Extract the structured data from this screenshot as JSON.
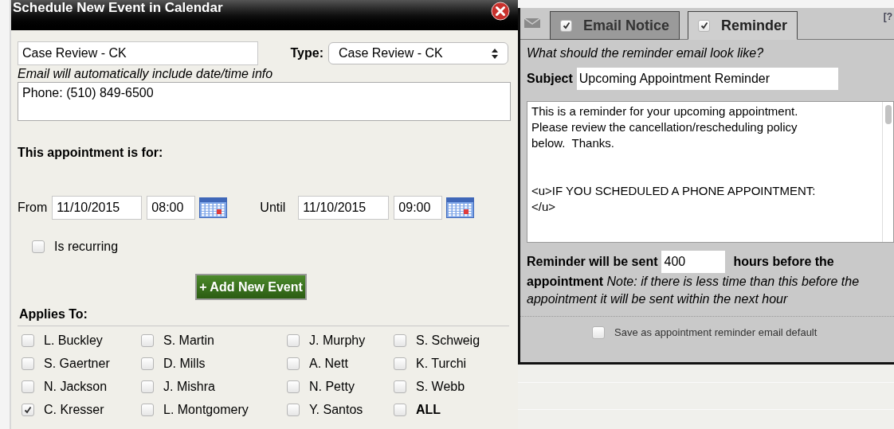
{
  "dialog": {
    "title": "Schedule New Event in Calendar",
    "event_name": "Case Review - CK",
    "type_label": "Type:",
    "type_value": "Case Review - CK",
    "email_note": "Email will automatically include date/time info",
    "details": "Phone: (510) 849-6500",
    "for_label": "This appointment is for:",
    "from_label": "From",
    "from_date": "11/10/2015",
    "from_time": "08:00",
    "until_label": "Until",
    "until_date": "11/10/2015",
    "until_time": "09:00",
    "recurring": {
      "label": "Is recurring",
      "checked": false
    },
    "add_button": "+ Add New Event",
    "applies_label": "Applies To:",
    "people": [
      {
        "name": "L. Buckley",
        "kind": "person",
        "checked": false
      },
      {
        "name": "S. Martin",
        "kind": "person",
        "checked": false
      },
      {
        "name": "J. Murphy",
        "kind": "person",
        "checked": false
      },
      {
        "name": "S. Schweig",
        "kind": "person",
        "checked": false
      },
      {
        "name": "S. Gaertner",
        "kind": "person",
        "checked": false
      },
      {
        "name": "D. Mills",
        "kind": "person",
        "checked": false
      },
      {
        "name": "A. Nett",
        "kind": "person",
        "checked": false
      },
      {
        "name": "K. Turchi",
        "kind": "person",
        "checked": false
      },
      {
        "name": "N. Jackson",
        "kind": "person",
        "checked": false
      },
      {
        "name": "J. Mishra",
        "kind": "person",
        "checked": false
      },
      {
        "name": "N. Petty",
        "kind": "person",
        "checked": false
      },
      {
        "name": "S. Webb",
        "kind": "person",
        "checked": false
      },
      {
        "name": "C. Kresser",
        "kind": "person",
        "checked": true
      },
      {
        "name": "L. Montgomery",
        "kind": "person",
        "checked": false
      },
      {
        "name": "Y. Santos",
        "kind": "person",
        "checked": false
      },
      {
        "name": "ALL",
        "kind": "all",
        "checked": false
      }
    ]
  },
  "email_panel": {
    "tabs": [
      {
        "label": "Email Notice",
        "checked": true,
        "selected": false
      },
      {
        "label": "Reminder",
        "checked": true,
        "selected": true
      }
    ],
    "help": "[?",
    "question": "What should the reminder email look like?",
    "subject_label": "Subject",
    "subject": "Upcoming Appointment Reminder",
    "body": "This is a reminder for your upcoming appointment.\nPlease review the cancellation/rescheduling policy\nbelow.  Thanks.\n\n\n<u>IF YOU SCHEDULED A PHONE APPOINTMENT:\n</u>",
    "reminder_prefix": "Reminder will be sent",
    "hours": "400",
    "reminder_suffix": "hours before the",
    "note": "**appointment** *Note: if there is less time than this before the appointment it will be sent within the next hour*",
    "save_default": {
      "label": "Save as appointment reminder email default",
      "checked": false
    }
  }
}
